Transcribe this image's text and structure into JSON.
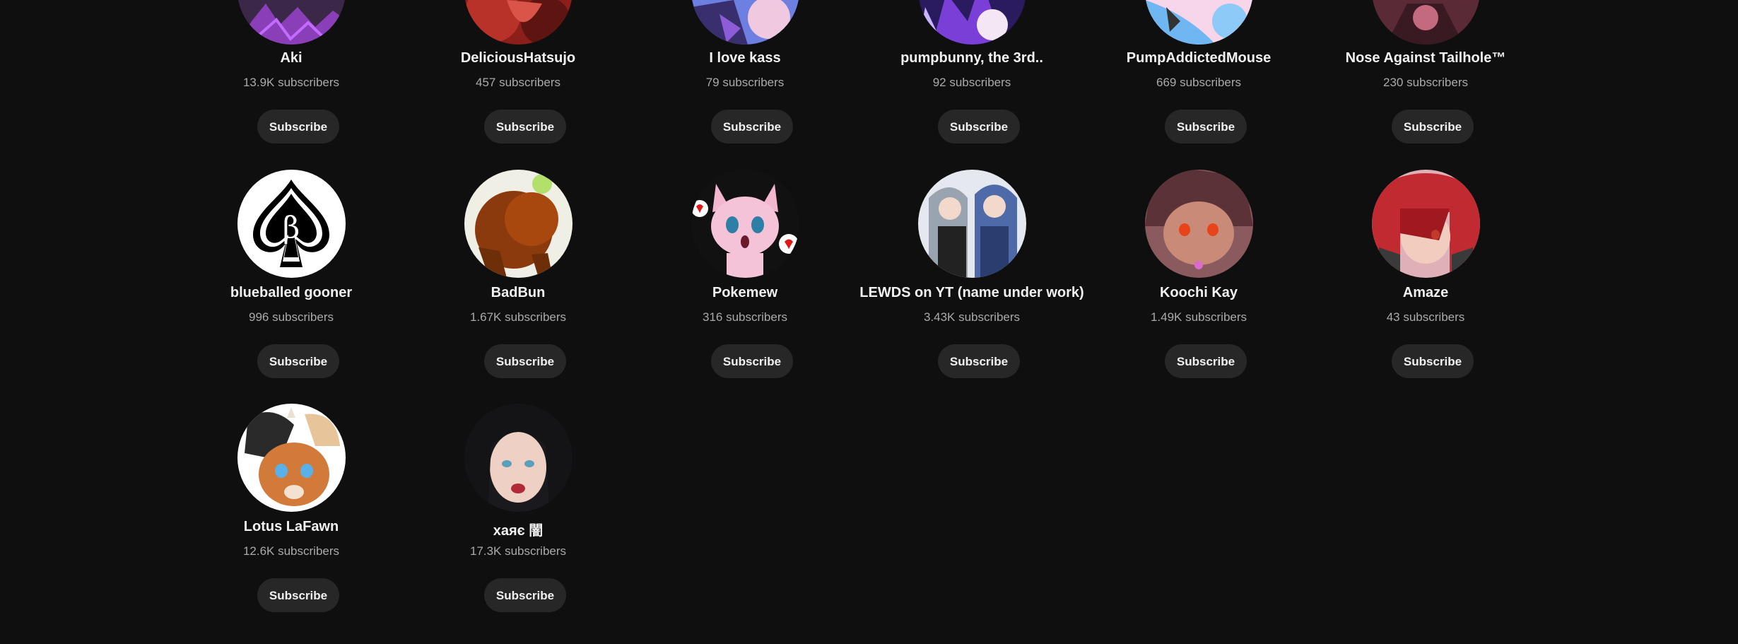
{
  "subscribe_label": "Subscribe",
  "channels": [
    {
      "name": "Aki",
      "subscribers": "13.9K subscribers",
      "avatar_icon": "dark-purple-art-avatar"
    },
    {
      "name": "DeliciousHatsujo",
      "subscribers": "457 subscribers",
      "avatar_icon": "red-art-avatar"
    },
    {
      "name": "I love kass",
      "subscribers": "79 subscribers",
      "avatar_icon": "blue-purple-art-avatar"
    },
    {
      "name": "pumpbunny, the 3rd..",
      "subscribers": "92 subscribers",
      "avatar_icon": "purple-bunny-avatar"
    },
    {
      "name": "PumpAddictedMouse",
      "subscribers": "669 subscribers",
      "avatar_icon": "blue-mouse-avatar"
    },
    {
      "name": "Nose Against Tailhole™",
      "subscribers": "230 subscribers",
      "avatar_icon": "dark-red-art-avatar"
    },
    {
      "name": "blueballed gooner",
      "subscribers": "996 subscribers",
      "avatar_icon": "spade-beta-avatar"
    },
    {
      "name": "BadBun",
      "subscribers": "1.67K subscribers",
      "avatar_icon": "brown-bunny-avatar"
    },
    {
      "name": "Pokemew",
      "subscribers": "316 subscribers",
      "avatar_icon": "pink-cat-avatar"
    },
    {
      "name": "LEWDS on YT (name under work)",
      "subscribers": "3.43K subscribers",
      "avatar_icon": "anime-characters-avatar"
    },
    {
      "name": "Koochi Kay",
      "subscribers": "1.49K subscribers",
      "avatar_icon": "brown-fox-avatar"
    },
    {
      "name": "Amaze",
      "subscribers": "43 subscribers",
      "avatar_icon": "red-hair-avatar"
    },
    {
      "name": "Lotus LaFawn",
      "subscribers": "12.6K subscribers",
      "avatar_icon": "fawn-avatar"
    },
    {
      "name": "xaяє 闇",
      "subscribers": "17.3K subscribers",
      "avatar_icon": "dark-hair-avatar"
    }
  ],
  "colors": {
    "background": "#0f0f0f",
    "button_bg": "#272727",
    "text_primary": "#f1f1f1",
    "text_secondary": "#aaaaaa"
  }
}
